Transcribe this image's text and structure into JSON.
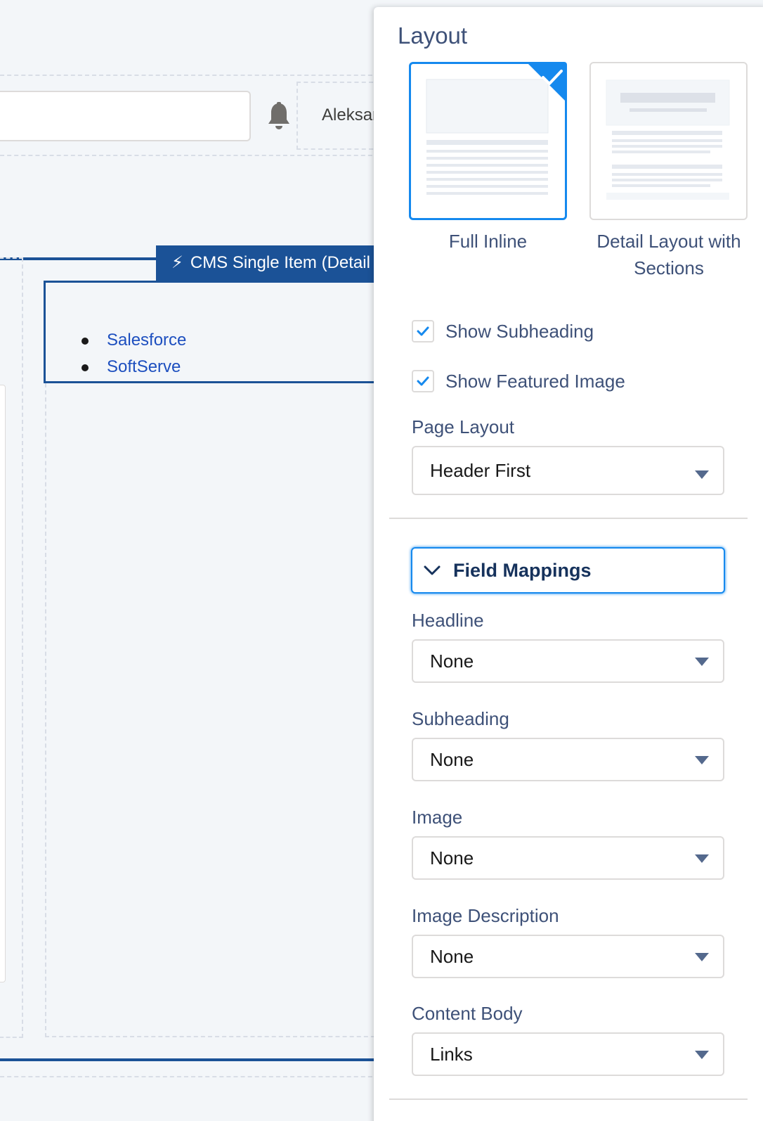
{
  "background": {
    "user_name": "Aleksar",
    "component_tab": "CMS Single Item (Detail",
    "links": [
      "Salesforce",
      "SoftServe"
    ]
  },
  "panel": {
    "title": "Layout",
    "layout_options": [
      {
        "label": "Full Inline",
        "selected": true
      },
      {
        "label_line1": "Detail Layout with",
        "label_line2": "Sections",
        "selected": false
      }
    ],
    "checkboxes": [
      {
        "label": "Show Subheading",
        "checked": true
      },
      {
        "label": "Show Featured Image",
        "checked": true
      }
    ],
    "page_layout": {
      "label": "Page Layout",
      "value": "Header First"
    },
    "field_mappings": {
      "section_label": "Field Mappings",
      "expanded": true,
      "fields": [
        {
          "label": "Headline",
          "value": "None"
        },
        {
          "label": "Subheading",
          "value": "None"
        },
        {
          "label": "Image",
          "value": "None"
        },
        {
          "label": "Image Description",
          "value": "None"
        },
        {
          "label": "Content Body",
          "value": "Links"
        }
      ]
    }
  },
  "colors": {
    "brand_blue": "#1b5297",
    "selection_blue": "#1589ee",
    "link_blue": "#1d4fbf",
    "label_text": "#3e5178"
  },
  "icons": [
    "bell-icon",
    "bolt-icon",
    "check-icon",
    "chevron-down-icon",
    "caret-down-icon"
  ]
}
